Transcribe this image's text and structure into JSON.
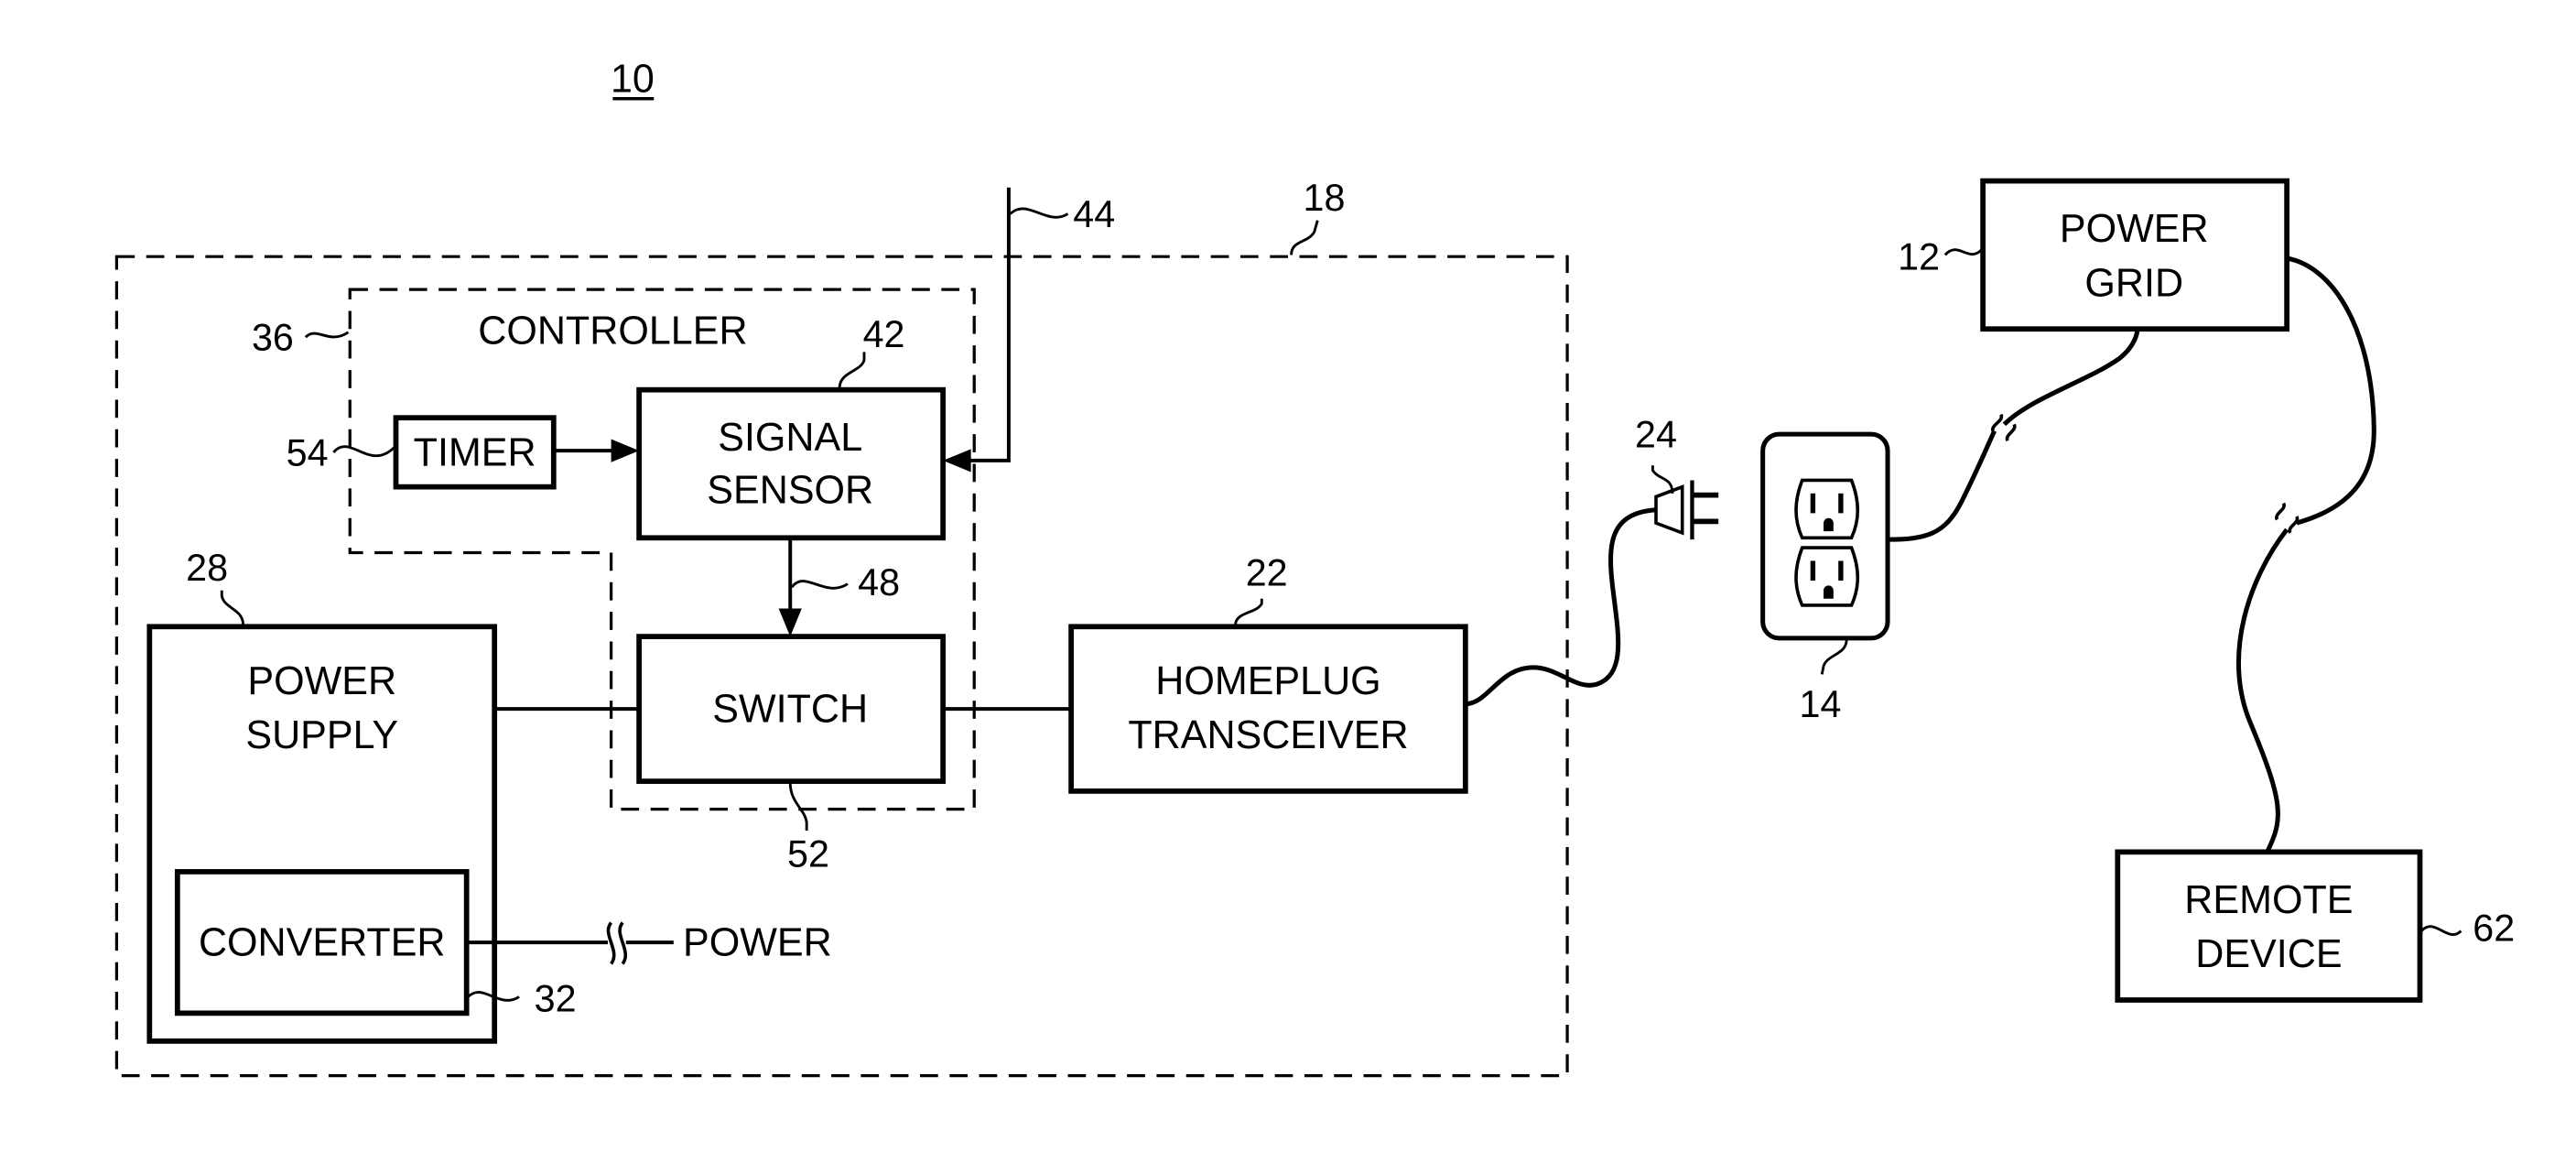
{
  "figure": {
    "number": "10"
  },
  "regions": {
    "device": {
      "ref": "18"
    },
    "controller": {
      "label": "CONTROLLER",
      "ref": "36"
    }
  },
  "blocks": {
    "timer": {
      "label": "TIMER",
      "ref": "54"
    },
    "signal_sensor": {
      "line1": "SIGNAL",
      "line2": "SENSOR",
      "ref": "42"
    },
    "switch": {
      "label": "SWITCH",
      "ref": "52"
    },
    "power_supply": {
      "line1": "POWER",
      "line2": "SUPPLY",
      "ref": "28"
    },
    "converter": {
      "label": "CONVERTER",
      "ref": "32"
    },
    "homeplug": {
      "line1": "HOMEPLUG",
      "line2": "TRANSCEIVER",
      "ref": "22"
    },
    "power_grid": {
      "line1": "POWER",
      "line2": "GRID",
      "ref": "12"
    },
    "remote_device": {
      "line1": "REMOTE",
      "line2": "DEVICE",
      "ref": "62"
    }
  },
  "connections": {
    "antenna_input": {
      "ref": "44"
    },
    "sensor_to_switch": {
      "ref": "48"
    },
    "plug": {
      "ref": "24"
    },
    "outlet": {
      "ref": "14"
    },
    "power_input": {
      "label": "POWER"
    }
  }
}
